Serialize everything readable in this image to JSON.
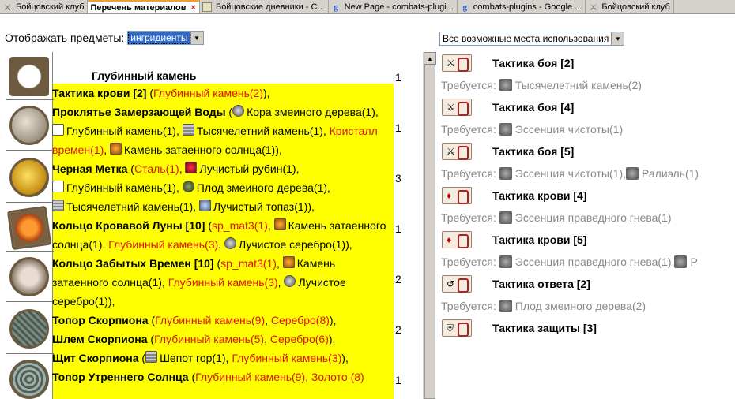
{
  "tabs": [
    {
      "label": "Бойцовский клуб",
      "icon": "crossed-swords-icon",
      "active": false
    },
    {
      "label": "Перечень материалов",
      "icon": "",
      "active": true,
      "close": "×"
    },
    {
      "label": "Бойцовские дневники - С...",
      "icon": "diary-icon",
      "active": false
    },
    {
      "label": "New Page - combats-plugi...",
      "icon": "google-icon",
      "active": false
    },
    {
      "label": "combats-plugins - Google ...",
      "icon": "google-icon",
      "active": false
    },
    {
      "label": "Бойцовский клуб",
      "icon": "crossed-swords-icon",
      "active": false
    }
  ],
  "filter": {
    "label": "Отображать предметы:",
    "value": "ингридиенты"
  },
  "places": {
    "value": "Все возможные места использования"
  },
  "materials": [
    {
      "icon": "deep-stone-icon",
      "count": "1"
    },
    {
      "icon": "snake-bark-icon",
      "count": "1"
    },
    {
      "icon": "gold-icon",
      "count": "3"
    },
    {
      "icon": "sun-stone-icon",
      "count": "1"
    },
    {
      "icon": "hand-icon",
      "count": "2"
    },
    {
      "icon": "scorpion-icon",
      "count": "2"
    },
    {
      "icon": "cane-icon",
      "count": "1"
    }
  ],
  "selected_material": "Глубинный камень",
  "recipes": {
    "r1": {
      "name": "Тактика крови [2]",
      "open": " (",
      "i1": "Глубинный камень(2)",
      "close": "),"
    },
    "r2": {
      "name": "Проклятье Замерзающей Воды",
      "open": " (",
      "i1": "Кора змеиного дерева(1), ",
      "i2": "Глубинный камень(1), ",
      "i3": "Тысячелетний камень(1), ",
      "i4": "Кристалл времен(1)",
      "sep4": ", ",
      "i5": "Камень затаенного солнца(1)),"
    },
    "r3": {
      "name": "Черная Метка",
      "open": " (",
      "i1": "Сталь(1)",
      "sep1": ", ",
      "i2": "Лучистый рубин(1),",
      "i3": "Глубинный камень(1), ",
      "i4": "Плод змеиного дерева(1),",
      "i5": "Тысячелетний камень(1), ",
      "i6": "Лучистый топаз(1)),"
    },
    "r4": {
      "name": "Кольцо Кровавой Луны [10]",
      "open": " (",
      "i1": "sp_mat3(1)",
      "sep1": ", ",
      "i2": "Камень затаенного солнца(1), ",
      "i3": "Глубинный камень(3)",
      "sep3": ", ",
      "i4": "Лучистое серебро(1)),"
    },
    "r5": {
      "name": "Кольцо Забытых Времен [10]",
      "open": " (",
      "i1": "sp_mat3(1)",
      "sep1": ", ",
      "i2": "Камень затаенного солнца(1), ",
      "i3": "Глубинный камень(3)",
      "sep3": ", ",
      "i4": "Лучистое серебро(1)),"
    },
    "r6": {
      "name": "Топор Скорпиона",
      "open": " (",
      "i1": "Глубинный камень(9)",
      "sep1": ", ",
      "i2": "Серебро(8)",
      "close": "),"
    },
    "r7": {
      "name": "Шлем Скорпиона",
      "open": " (",
      "i1": "Глубинный камень(5)",
      "sep1": ", ",
      "i2": "Серебро(6)",
      "close": "),"
    },
    "r8": {
      "name": "Щит Скорпиона",
      "open": " (",
      "i1": "Шепот гор(1), ",
      "i2": "Глубинный камень(3)",
      "close": "),"
    },
    "r9": {
      "name": "Топор Утреннего Солнца",
      "open": " (",
      "i1": "Глубинный камень(9)",
      "sep1": ", ",
      "i2": "Золото (8)"
    }
  },
  "tactics": [
    {
      "name": "Тактика боя [2]",
      "requires_label": "Требуется:",
      "requires": [
        "Тысячелетний камень(2)"
      ]
    },
    {
      "name": "Тактика боя [4]",
      "requires_label": "Требуется:",
      "requires": [
        "Эссенция чистоты(1)"
      ]
    },
    {
      "name": "Тактика боя [5]",
      "requires_label": "Требуется:",
      "requires": [
        "Эссенция чистоты(1), ",
        "Ралиэль(1)"
      ]
    },
    {
      "name": "Тактика крови [4]",
      "requires_label": "Требуется:",
      "requires": [
        "Эссенция праведного гнева(1)"
      ]
    },
    {
      "name": "Тактика крови [5]",
      "requires_label": "Требуется:",
      "requires": [
        "Эссенция праведного гнева(1), ",
        "Р"
      ]
    },
    {
      "name": "Тактика ответа [2]",
      "requires_label": "Требуется:",
      "requires": [
        "Плод змеиного дерева(2)"
      ]
    },
    {
      "name": "Тактика защиты [3]"
    }
  ],
  "colors": {
    "highlight": "#ffff00",
    "ingredient_link": "#dd1111",
    "muted": "#888888"
  }
}
